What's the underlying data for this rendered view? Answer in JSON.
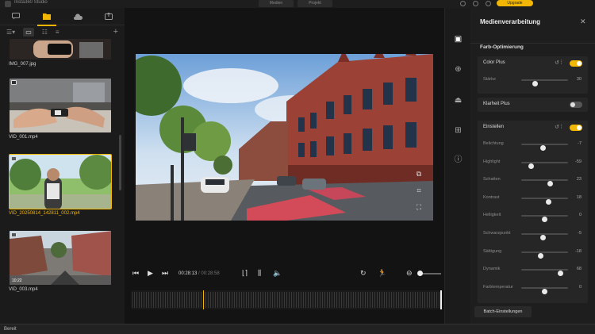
{
  "app": {
    "title": "Insta360 Studio"
  },
  "topbar": {
    "tabs": [
      "Medien",
      "Projekt"
    ],
    "upgrade_label": "Upgrade"
  },
  "media": {
    "categories": [
      "chat-icon",
      "folder-icon",
      "cloud-icon",
      "export-icon"
    ],
    "views": [
      "sort-icon",
      "grid-icon",
      "list-icon",
      "compact-list-icon"
    ],
    "items": [
      {
        "name": "IMG_007.jpg",
        "duration": ""
      },
      {
        "name": "VID_001.mp4",
        "duration": ""
      },
      {
        "name": "VID_20250814_142811_002.mp4",
        "duration": ""
      },
      {
        "name": "VID_003.mp4",
        "duration": "10:22"
      }
    ],
    "selected_index": 2
  },
  "player": {
    "current_time": "00:28:13",
    "separator": " / ",
    "total_time": "00:28:58"
  },
  "panel": {
    "title": "Medienverarbeitung",
    "section_color": "Farb-Optimierung",
    "color_plus_label": "Color Plus",
    "color_plus_on": true,
    "strength": {
      "label": "Stärke",
      "value": "30",
      "level": 0.3
    },
    "clarity_plus_label": "Klarheit Plus",
    "clarity_plus_on": false,
    "adjust_label": "Einstellen",
    "adjust_on": true,
    "sliders": [
      {
        "label": "Belichtung",
        "value": "-7",
        "level": 0.47
      },
      {
        "label": "Highlight",
        "value": "-59",
        "level": 0.21
      },
      {
        "label": "Schatten",
        "value": "23",
        "level": 0.62
      },
      {
        "label": "Kontrast",
        "value": "18",
        "level": 0.59
      },
      {
        "label": "Helligkeit",
        "value": "0",
        "level": 0.5
      },
      {
        "label": "Schwarzpunkt",
        "value": "-5",
        "level": 0.47
      },
      {
        "label": "Sättigung",
        "value": "-18",
        "level": 0.41
      },
      {
        "label": "Dynamik",
        "value": "68",
        "level": 0.84
      },
      {
        "label": "Farbtemperatur",
        "value": "0",
        "level": 0.5
      }
    ],
    "batch_label": "Batch-Einstellungen"
  },
  "status": {
    "text": "Bereit"
  },
  "colors": {
    "accent": "#f2b705",
    "background": "#161616",
    "panel": "#1e1e1e"
  }
}
